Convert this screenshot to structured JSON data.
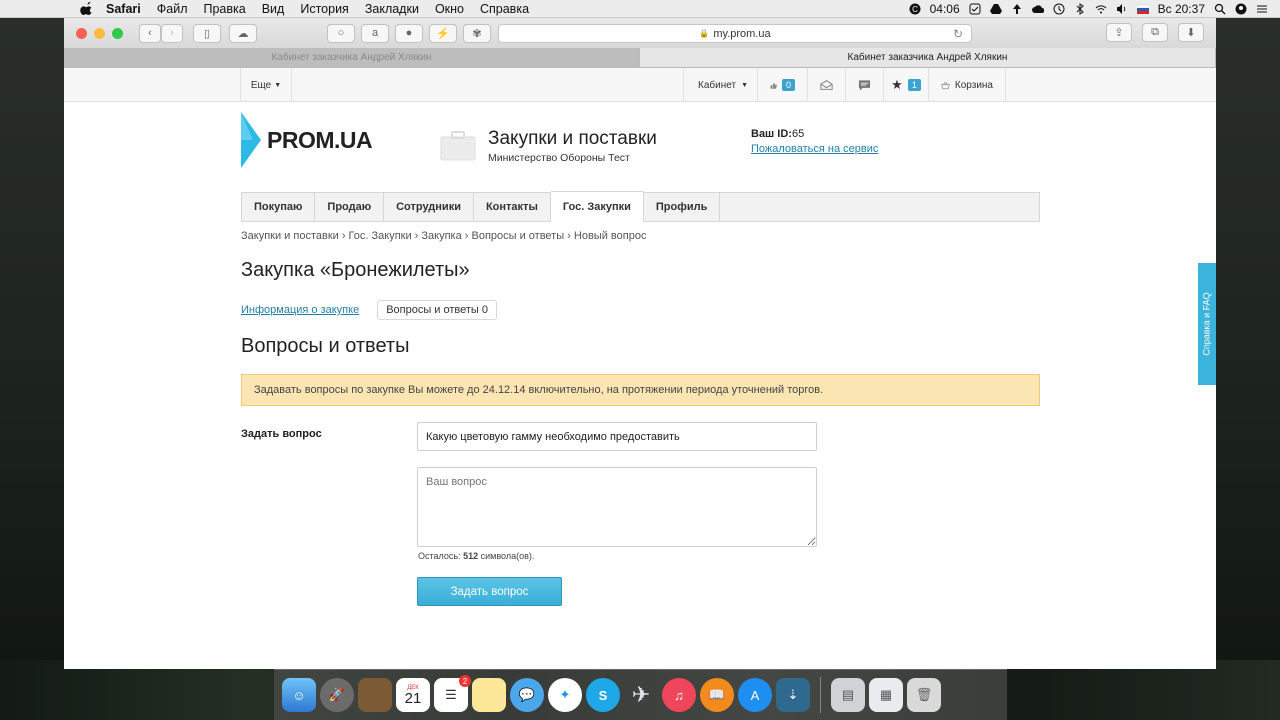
{
  "menubar": {
    "app": "Safari",
    "items": [
      "Файл",
      "Правка",
      "Вид",
      "История",
      "Закладки",
      "Окно",
      "Справка"
    ],
    "timer": "04:06",
    "datetime": "Вс 20:37"
  },
  "browser": {
    "address": "my.prom.ua",
    "tabs": [
      "Кабинет заказчика Андрей Хлякин",
      "Кабинет заказчика Андрей Хлякин"
    ]
  },
  "sitebar": {
    "more": "Еще",
    "cabinet": "Кабинет",
    "likes_count": "0",
    "favorites_count": "1",
    "cart": "Корзина"
  },
  "header": {
    "logo": "PROM.UA",
    "project_title": "Закупки и поставки",
    "project_subtitle": "Министерство Обороны Тест",
    "user_id_label": "Ваш ID:",
    "user_id_value": "65",
    "complain_link": "Пожаловаться на сервис"
  },
  "nav": {
    "tabs": [
      "Покупаю",
      "Продаю",
      "Сотрудники",
      "Контакты",
      "Гос. Закупки",
      "Профиль"
    ],
    "active_index": 4
  },
  "breadcrumb": "Закупки и поставки › Гос. Закупки › Закупка › Вопросы и ответы › Новый вопрос",
  "page": {
    "title": "Закупка «Бронежилеты»",
    "subtab_info": "Информация о закупке",
    "subtab_qa": "Вопросы и ответы",
    "subtab_qa_count": "0",
    "section_title": "Вопросы и ответы",
    "notice": "Задавать вопросы по закупке Вы можете до 24.12.14 включительно, на протяжении периода уточнений торгов."
  },
  "form": {
    "label": "Задать вопрос",
    "subject_value": "Какую цветовую гамму необходимо предоставить",
    "question_placeholder": "Ваш вопрос",
    "remaining_prefix": "Осталось:",
    "remaining_count": "512",
    "remaining_suffix": "символа(ов).",
    "submit": "Задать вопрос"
  },
  "help_tab": "Справка и FAQ",
  "dock": {
    "calendar_month": "ДЕК",
    "calendar_day": "21",
    "reminders_badge": "2"
  }
}
